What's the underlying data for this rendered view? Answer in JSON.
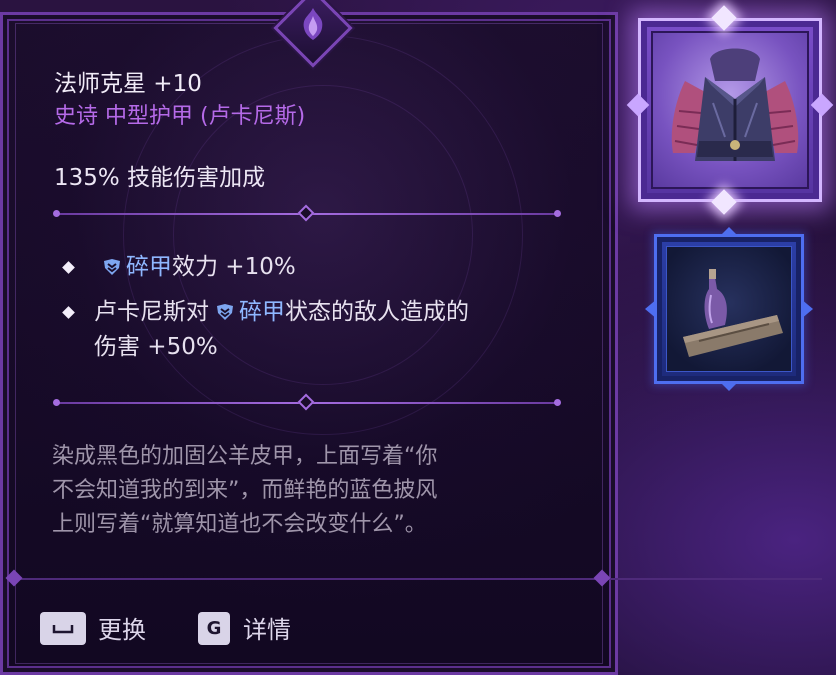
{
  "item": {
    "name": "法师克星 +10",
    "subtitle": "史诗 中型护甲 (卢卡尼斯)",
    "stat": "135% 技能伤害加成"
  },
  "affixes": [
    {
      "keyword": "碎甲",
      "text": "效力 +10%"
    },
    {
      "prefix": "卢卡尼斯对",
      "keyword": "碎甲",
      "line1_suffix": "状态的敌人造成的",
      "line2": "伤害 +50%"
    }
  ],
  "flavor": {
    "line1": "染成黑色的加固公羊皮甲，上面写着“你",
    "line2": "不会知道我的到来”，而鲜艳的蓝色披风",
    "line3": "上则写着“就算知道也不会改变什么”。"
  },
  "footer": {
    "swap_key": "␣",
    "swap_label": "更换",
    "details_key": "G",
    "details_label": "详情"
  },
  "icons": {
    "crest": "rogue-crest-icon",
    "vulnerable": "sunder-status-icon",
    "armor": "armor-item-icon",
    "potion": "potion-item-icon"
  },
  "colors": {
    "epic": "#b56ae8",
    "keyword": "#8fb7ff",
    "flavor": "#9f95aa",
    "frame": "#6c3aa3"
  }
}
